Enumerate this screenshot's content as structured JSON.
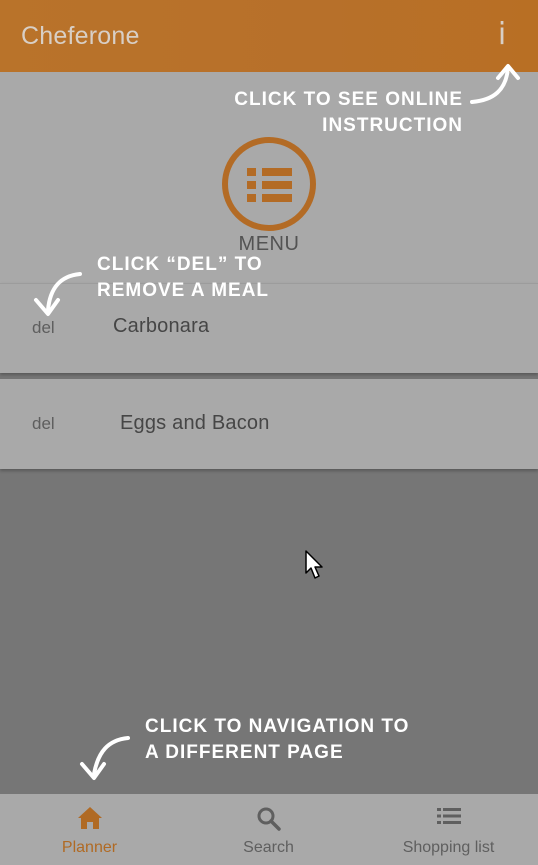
{
  "header": {
    "title": "Cheferone",
    "info_glyph": "i"
  },
  "menu": {
    "label": "MENU",
    "icon": "list-circle-icon"
  },
  "meals": [
    {
      "del_label": "del",
      "name": "Carbonara"
    },
    {
      "del_label": "del",
      "name": "Eggs and Bacon"
    }
  ],
  "annotations": {
    "info_line1": "CLICK TO SEE ONLINE",
    "info_line2": "INSTRUCTION",
    "del_line1": "CLICK “DEL” TO",
    "del_line2": "REMOVE A MEAL",
    "nav_line1": "CLICK TO NAVIGATION TO",
    "nav_line2": "A DIFFERENT PAGE"
  },
  "bottom_nav": {
    "items": [
      {
        "label": "Planner",
        "icon": "home-icon"
      },
      {
        "label": "Search",
        "icon": "search-icon"
      },
      {
        "label": "Shopping list",
        "icon": "list-icon"
      }
    ]
  },
  "colors": {
    "accent": "#b9732a",
    "overlay_dark": "#767676",
    "panel": "#a9a9a9",
    "annotation": "#ffffff"
  }
}
